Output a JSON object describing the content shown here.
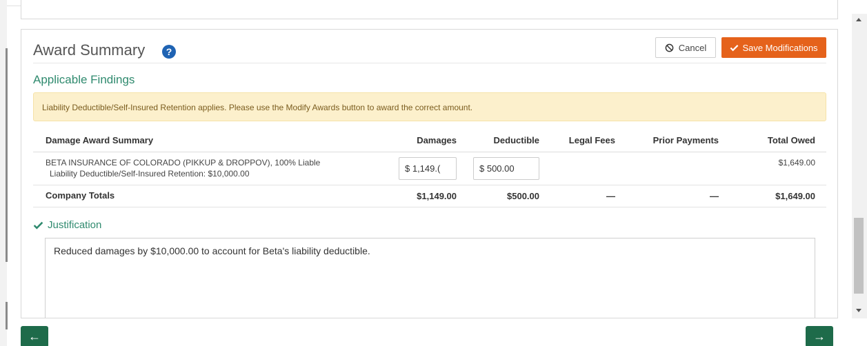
{
  "card": {
    "title": "Award Summary",
    "help_icon": "question-circle-icon",
    "cancel_label": "Cancel",
    "save_label": "Save Modifications",
    "subtitle": "Applicable Findings",
    "alert_text": "Liability Deductible/Self-Insured Retention applies.  Please use the Modify Awards button to award the correct amount."
  },
  "table": {
    "headers": [
      "Damage Award Summary",
      "Damages",
      "Deductible",
      "Legal Fees",
      "Prior Payments",
      "Total Owed"
    ],
    "row": {
      "company": "BETA INSURANCE OF COLORADO (PIKKUP & DROPPOV), 100% Liable",
      "detail": "Liability Deductible/Self-Insured Retention: $10,000.00",
      "damages_input": "$ 1,149.(",
      "deductible_input": "$ 500.00",
      "legal_fees": "",
      "prior_payments": "",
      "total_owed": "$1,649.00"
    },
    "totals": {
      "label": "Company Totals",
      "damages": "$1,149.00",
      "deductible": "$500.00",
      "legal_fees": "—",
      "prior_payments": "—",
      "total_owed": "$1,649.00"
    }
  },
  "justification": {
    "label": "Justification",
    "text": "Reduced damages by $10,000.00 to account for Beta's liability deductible."
  },
  "nav": {
    "back_icon": "←",
    "next_icon": "→"
  },
  "colors": {
    "accent_green": "#2f8a6e",
    "save_orange": "#e5621b",
    "nav_green": "#1e6b4a",
    "alert_bg": "#fcf0cc"
  }
}
